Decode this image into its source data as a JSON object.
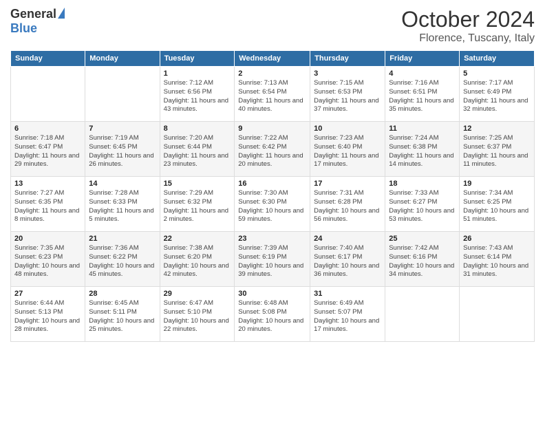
{
  "header": {
    "logo_general": "General",
    "logo_blue": "Blue",
    "month": "October 2024",
    "location": "Florence, Tuscany, Italy"
  },
  "days_of_week": [
    "Sunday",
    "Monday",
    "Tuesday",
    "Wednesday",
    "Thursday",
    "Friday",
    "Saturday"
  ],
  "weeks": [
    [
      {
        "day": "",
        "info": ""
      },
      {
        "day": "",
        "info": ""
      },
      {
        "day": "1",
        "info": "Sunrise: 7:12 AM\nSunset: 6:56 PM\nDaylight: 11 hours and 43 minutes."
      },
      {
        "day": "2",
        "info": "Sunrise: 7:13 AM\nSunset: 6:54 PM\nDaylight: 11 hours and 40 minutes."
      },
      {
        "day": "3",
        "info": "Sunrise: 7:15 AM\nSunset: 6:53 PM\nDaylight: 11 hours and 37 minutes."
      },
      {
        "day": "4",
        "info": "Sunrise: 7:16 AM\nSunset: 6:51 PM\nDaylight: 11 hours and 35 minutes."
      },
      {
        "day": "5",
        "info": "Sunrise: 7:17 AM\nSunset: 6:49 PM\nDaylight: 11 hours and 32 minutes."
      }
    ],
    [
      {
        "day": "6",
        "info": "Sunrise: 7:18 AM\nSunset: 6:47 PM\nDaylight: 11 hours and 29 minutes."
      },
      {
        "day": "7",
        "info": "Sunrise: 7:19 AM\nSunset: 6:45 PM\nDaylight: 11 hours and 26 minutes."
      },
      {
        "day": "8",
        "info": "Sunrise: 7:20 AM\nSunset: 6:44 PM\nDaylight: 11 hours and 23 minutes."
      },
      {
        "day": "9",
        "info": "Sunrise: 7:22 AM\nSunset: 6:42 PM\nDaylight: 11 hours and 20 minutes."
      },
      {
        "day": "10",
        "info": "Sunrise: 7:23 AM\nSunset: 6:40 PM\nDaylight: 11 hours and 17 minutes."
      },
      {
        "day": "11",
        "info": "Sunrise: 7:24 AM\nSunset: 6:38 PM\nDaylight: 11 hours and 14 minutes."
      },
      {
        "day": "12",
        "info": "Sunrise: 7:25 AM\nSunset: 6:37 PM\nDaylight: 11 hours and 11 minutes."
      }
    ],
    [
      {
        "day": "13",
        "info": "Sunrise: 7:27 AM\nSunset: 6:35 PM\nDaylight: 11 hours and 8 minutes."
      },
      {
        "day": "14",
        "info": "Sunrise: 7:28 AM\nSunset: 6:33 PM\nDaylight: 11 hours and 5 minutes."
      },
      {
        "day": "15",
        "info": "Sunrise: 7:29 AM\nSunset: 6:32 PM\nDaylight: 11 hours and 2 minutes."
      },
      {
        "day": "16",
        "info": "Sunrise: 7:30 AM\nSunset: 6:30 PM\nDaylight: 10 hours and 59 minutes."
      },
      {
        "day": "17",
        "info": "Sunrise: 7:31 AM\nSunset: 6:28 PM\nDaylight: 10 hours and 56 minutes."
      },
      {
        "day": "18",
        "info": "Sunrise: 7:33 AM\nSunset: 6:27 PM\nDaylight: 10 hours and 53 minutes."
      },
      {
        "day": "19",
        "info": "Sunrise: 7:34 AM\nSunset: 6:25 PM\nDaylight: 10 hours and 51 minutes."
      }
    ],
    [
      {
        "day": "20",
        "info": "Sunrise: 7:35 AM\nSunset: 6:23 PM\nDaylight: 10 hours and 48 minutes."
      },
      {
        "day": "21",
        "info": "Sunrise: 7:36 AM\nSunset: 6:22 PM\nDaylight: 10 hours and 45 minutes."
      },
      {
        "day": "22",
        "info": "Sunrise: 7:38 AM\nSunset: 6:20 PM\nDaylight: 10 hours and 42 minutes."
      },
      {
        "day": "23",
        "info": "Sunrise: 7:39 AM\nSunset: 6:19 PM\nDaylight: 10 hours and 39 minutes."
      },
      {
        "day": "24",
        "info": "Sunrise: 7:40 AM\nSunset: 6:17 PM\nDaylight: 10 hours and 36 minutes."
      },
      {
        "day": "25",
        "info": "Sunrise: 7:42 AM\nSunset: 6:16 PM\nDaylight: 10 hours and 34 minutes."
      },
      {
        "day": "26",
        "info": "Sunrise: 7:43 AM\nSunset: 6:14 PM\nDaylight: 10 hours and 31 minutes."
      }
    ],
    [
      {
        "day": "27",
        "info": "Sunrise: 6:44 AM\nSunset: 5:13 PM\nDaylight: 10 hours and 28 minutes."
      },
      {
        "day": "28",
        "info": "Sunrise: 6:45 AM\nSunset: 5:11 PM\nDaylight: 10 hours and 25 minutes."
      },
      {
        "day": "29",
        "info": "Sunrise: 6:47 AM\nSunset: 5:10 PM\nDaylight: 10 hours and 22 minutes."
      },
      {
        "day": "30",
        "info": "Sunrise: 6:48 AM\nSunset: 5:08 PM\nDaylight: 10 hours and 20 minutes."
      },
      {
        "day": "31",
        "info": "Sunrise: 6:49 AM\nSunset: 5:07 PM\nDaylight: 10 hours and 17 minutes."
      },
      {
        "day": "",
        "info": ""
      },
      {
        "day": "",
        "info": ""
      }
    ]
  ]
}
